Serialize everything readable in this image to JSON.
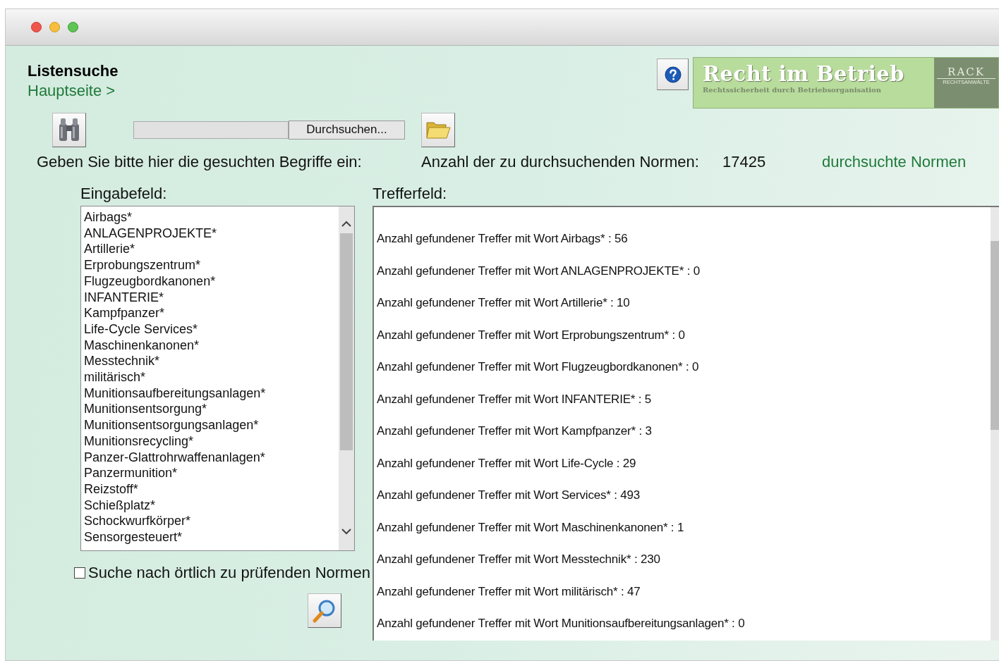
{
  "header": {
    "title": "Listensuche",
    "breadcrumb": "Hauptseite >"
  },
  "logo": {
    "title": "Recht im Betrieb",
    "subtitle": "Rechtssicherheit durch Betriebsorganisation",
    "brand": "RACK",
    "brand_sub": "RECHTSANWÄLTE"
  },
  "file_picker": {
    "button": "Durchsuchen..."
  },
  "prompt": "Geben Sie bitte hier die gesuchten Begriffe ein:",
  "norm_count": {
    "label": "Anzahl der zu durchsuchenden Normen:",
    "value": "17425",
    "link": "durchsuchte Normen"
  },
  "input_list": {
    "label": "Eingabefeld:",
    "items": [
      "Airbags*",
      "ANLAGENPROJEKTE*",
      "Artillerie*",
      "Erprobungszentrum*",
      "Flugzeugbordkanonen*",
      "INFANTERIE*",
      "Kampfpanzer*",
      "Life-Cycle Services*",
      "Maschinenkanonen*",
      "Messtechnik*",
      "militärisch*",
      "Munitionsaufbereitungsanlagen*",
      "Munitionsentsorgung*",
      "Munitionsentsorgungsanlagen*",
      "Munitionsrecycling*",
      "Panzer-Glattrohrwaffenanlagen*",
      "Panzermunition*",
      "Reizstoff*",
      "Schießplatz*",
      "Schockwurfkörper*",
      "Sensorgesteuert*"
    ]
  },
  "local_check": {
    "label": "Suche nach örtlich zu prüfenden Normen",
    "checked": false
  },
  "results": {
    "label": "Trefferfeld:",
    "rows": [
      "Anzahl gefundener Treffer mit Wort Airbags* : 56",
      "Anzahl gefundener Treffer mit Wort ANLAGENPROJEKTE* : 0",
      "Anzahl gefundener Treffer mit Wort Artillerie* : 10",
      "Anzahl gefundener Treffer mit Wort Erprobungszentrum* : 0",
      "Anzahl gefundener Treffer mit Wort Flugzeugbordkanonen* : 0",
      "Anzahl gefundener Treffer mit Wort INFANTERIE* : 5",
      "Anzahl gefundener Treffer mit Wort Kampfpanzer* : 3",
      "Anzahl gefundener Treffer mit Wort Life-Cycle : 29",
      "Anzahl gefundener Treffer mit Wort Services* : 493",
      "Anzahl gefundener Treffer mit Wort Maschinenkanonen* : 1",
      "Anzahl gefundener Treffer mit Wort Messtechnik* : 230",
      "Anzahl gefundener Treffer mit Wort militärisch* : 47",
      "Anzahl gefundener Treffer mit Wort Munitionsaufbereitungsanlagen* : 0"
    ]
  }
}
